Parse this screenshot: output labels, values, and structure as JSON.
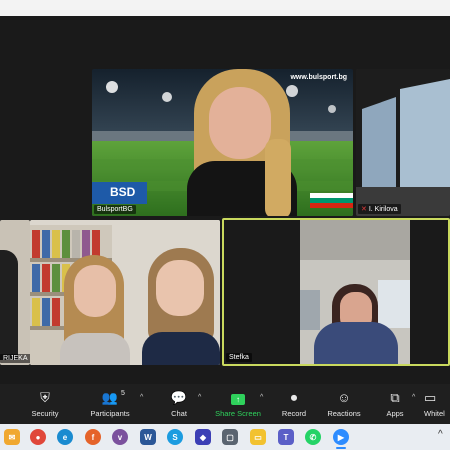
{
  "meeting": {
    "tiles": [
      {
        "id": "main",
        "name": "BulsportBG",
        "watermark": "www.bulsport.bg",
        "logo_text": "BSD"
      },
      {
        "id": "right",
        "name": "I. Kirilova"
      },
      {
        "id": "left-cut",
        "name": "RIJEKA"
      },
      {
        "id": "group",
        "name": ""
      },
      {
        "id": "active",
        "name": "Stefka"
      }
    ]
  },
  "toolbar": {
    "items": [
      {
        "label": "Security",
        "icon": "shield-icon"
      },
      {
        "label": "Participants",
        "icon": "participants-icon",
        "count": "5"
      },
      {
        "label": "Chat",
        "icon": "chat-icon"
      },
      {
        "label": "Share Screen",
        "icon": "share-screen-icon"
      },
      {
        "label": "Record",
        "icon": "record-icon"
      },
      {
        "label": "Reactions",
        "icon": "reactions-icon"
      },
      {
        "label": "Apps",
        "icon": "apps-icon"
      },
      {
        "label": "Whitel",
        "icon": "whiteboard-icon"
      }
    ]
  },
  "taskbar": {
    "apps": [
      "notifications",
      "chrome",
      "edge",
      "firefox",
      "viber",
      "word",
      "skype",
      "deskpins",
      "copilot",
      "explorer",
      "teams",
      "whatsapp",
      "zoom"
    ]
  },
  "colors": {
    "accent_green": "#2fd15c",
    "active_border": "#c9d95e",
    "pitch_green": "#3d8a2c"
  }
}
